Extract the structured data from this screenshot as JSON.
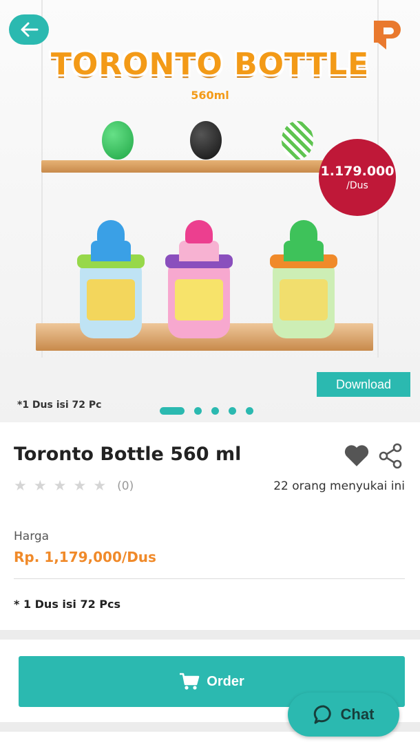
{
  "hero": {
    "title": "TORONTO BOTTLE",
    "subtitle": "560ml",
    "badge_price": "1.179.000",
    "badge_unit": "/Dus",
    "download_label": "Download",
    "note": "*1 Dus isi 72 Pc",
    "slide_count": 5,
    "active_slide": 1
  },
  "product": {
    "title": "Toronto Bottle 560 ml",
    "rating_stars": 0,
    "rating_count": "(0)",
    "likes_text": "22 orang menyukai ini",
    "price_label": "Harga",
    "price_value": "Rp. 1,179,000/Dus",
    "note": "* 1 Dus isi 72 Pcs"
  },
  "actions": {
    "order_label": "Order",
    "chat_label": "Chat"
  },
  "colors": {
    "accent": "#2bb9b0",
    "price": "#f08a2a",
    "badge": "#bf1838",
    "logo": "#e9792e"
  },
  "icons": [
    "back-arrow-icon",
    "brand-logo",
    "heart-icon",
    "share-icon",
    "star-icon",
    "cart-icon",
    "chat-bubble-icon"
  ]
}
